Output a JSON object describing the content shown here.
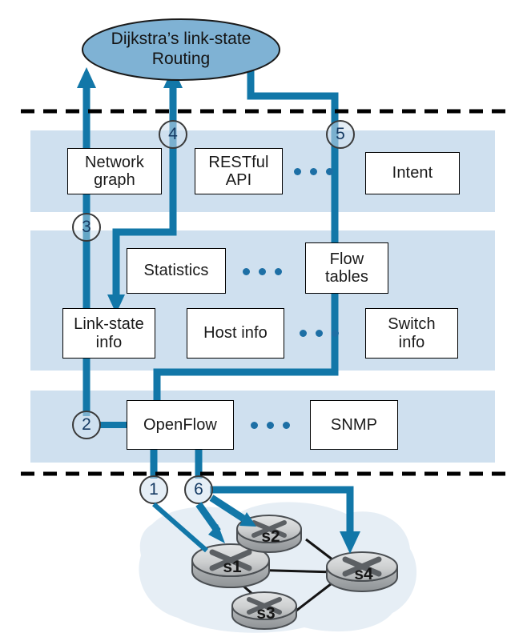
{
  "figure": {
    "title": "SDN controller architecture with link-state routing example",
    "colors": {
      "arrow_blue": "#1277a8",
      "band_blue": "#cfe0ef",
      "ellipse_fill": "#7fb2d4",
      "ellipse_stroke": "#1a1a1a",
      "cloud_fill": "#e6eef5",
      "box_fill": "#ffffff",
      "box_stroke": "#000000",
      "link_black": "#141414",
      "link_blue": "#1277a8",
      "router_body": "#c9cbcc",
      "router_stroke": "#4a4e52",
      "dashed_line": "#000000",
      "number_text": "#153a63"
    }
  },
  "top_app": {
    "name": "routing-application-ellipse",
    "line1": "Dijkstra’s link-state",
    "line2": "Routing"
  },
  "layers": [
    {
      "name": "northbound-api-layer",
      "boxes": [
        {
          "name": "network-graph-box",
          "line1": "Network",
          "line2": "graph"
        },
        {
          "name": "restful-api-box",
          "line1": "RESTful",
          "line2": "API"
        },
        {
          "name": "intent-box",
          "line1": "Intent",
          "line2": ""
        }
      ],
      "ellipsis": "• • •"
    },
    {
      "name": "network-wide-state-layer",
      "boxes": [
        {
          "name": "statistics-box",
          "line1": "Statistics",
          "line2": ""
        },
        {
          "name": "flow-tables-box",
          "line1": "Flow",
          "line2": "tables"
        },
        {
          "name": "link-state-info-box",
          "line1": "Link-state",
          "line2": "info"
        },
        {
          "name": "host-info-box",
          "line1": "Host info",
          "line2": ""
        },
        {
          "name": "switch-info-box",
          "line1": "Switch",
          "line2": "info"
        }
      ],
      "ellipsis": "• • •"
    },
    {
      "name": "southbound-protocol-layer",
      "boxes": [
        {
          "name": "openflow-box",
          "line1": "OpenFlow",
          "line2": ""
        },
        {
          "name": "snmp-box",
          "line1": "SNMP",
          "line2": ""
        }
      ],
      "ellipsis": "• • •"
    }
  ],
  "step_markers": [
    {
      "name": "step-marker-1",
      "label": "1"
    },
    {
      "name": "step-marker-2",
      "label": "2"
    },
    {
      "name": "step-marker-3",
      "label": "3"
    },
    {
      "name": "step-marker-4",
      "label": "4"
    },
    {
      "name": "step-marker-5",
      "label": "5"
    },
    {
      "name": "step-marker-6",
      "label": "6"
    }
  ],
  "network": {
    "name": "data-plane-network",
    "switches": [
      {
        "name": "switch-s1",
        "label": "s1"
      },
      {
        "name": "switch-s2",
        "label": "s2"
      },
      {
        "name": "switch-s3",
        "label": "s3"
      },
      {
        "name": "switch-s4",
        "label": "s4"
      }
    ],
    "links": [
      {
        "from": "s1",
        "to": "s2",
        "color": "#1277a8"
      },
      {
        "from": "s1",
        "to": "s4",
        "color": "#141414"
      },
      {
        "from": "s1",
        "to": "s3",
        "color": "#141414"
      },
      {
        "from": "s2",
        "to": "s4",
        "color": "#141414"
      },
      {
        "from": "s3",
        "to": "s4",
        "color": "#141414"
      }
    ]
  }
}
